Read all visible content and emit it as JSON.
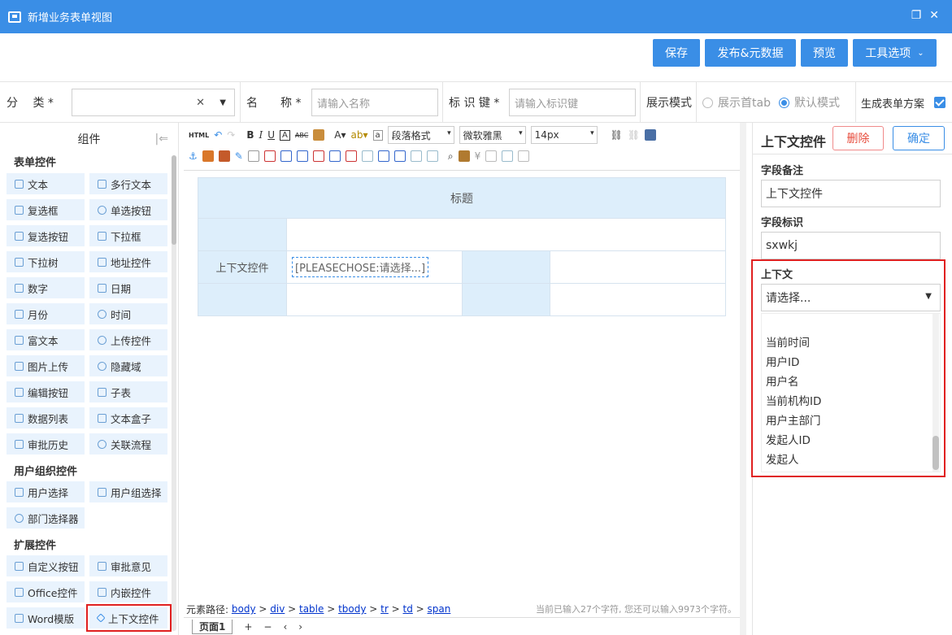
{
  "window": {
    "title": "新增业务表单视图"
  },
  "actions": {
    "save": "保存",
    "publish": "发布&元数据",
    "preview": "预览",
    "tools": "工具选项"
  },
  "form": {
    "category_label": "分　 类 *",
    "name_label": "名　　称 *",
    "name_placeholder": "请输入名称",
    "key_label": "标 识 键 *",
    "key_placeholder": "请输入标识键",
    "display_mode_label": "展示模式",
    "mode_first_tab": "展示首tab",
    "mode_default": "默认模式",
    "gen_plan_label": "生成表单方案"
  },
  "left_panel": {
    "title": "组件",
    "groups": [
      {
        "title": "表单控件",
        "items": [
          "文本",
          "多行文本",
          "复选框",
          "单选按钮",
          "复选按钮",
          "下拉框",
          "下拉树",
          "地址控件",
          "数字",
          "日期",
          "月份",
          "时间",
          "富文本",
          "上传控件",
          "图片上传",
          "隐藏域",
          "编辑按钮",
          "子表",
          "数据列表",
          "文本盒子",
          "审批历史",
          "关联流程"
        ]
      },
      {
        "title": "用户组织控件",
        "items": [
          "用户选择",
          "用户组选择",
          "部门选择器"
        ]
      },
      {
        "title": "扩展控件",
        "items": [
          "自定义按钮",
          "审批意见",
          "Office控件",
          "内嵌控件",
          "Word模版",
          "上下文控件"
        ]
      }
    ]
  },
  "editor": {
    "paragraph_select": "段落格式",
    "font_select": "微软雅黑",
    "size_select": "14px",
    "table_title": "标题",
    "row_label": "上下文控件",
    "placeholder_tag": "[PLEASECHOSE:请选择...]",
    "path_label": "元素路径:",
    "path": [
      "body",
      "div",
      "table",
      "tbody",
      "tr",
      "td",
      "span"
    ],
    "char_count": "当前已输入27个字符, 您还可以输入9973个字符。",
    "page_tab": "页面1",
    "page_controls": [
      "+",
      "−",
      "‹",
      "›"
    ]
  },
  "right_panel": {
    "title": "上下文控件",
    "delete": "删除",
    "confirm": "确定",
    "note_label": "字段备注",
    "note_value": "上下文控件",
    "key_label": "字段标识",
    "key_value": "sxwkj",
    "context_label": "上下文",
    "context_select": "请选择...",
    "options": [
      "当前时间",
      "用户ID",
      "用户名",
      "当前机构ID",
      "用户主部门",
      "发起人ID",
      "发起人"
    ]
  },
  "colors": {
    "accent": "#3a8ee6",
    "highlight": "#e02020",
    "cell_bg": "#ddeefb"
  }
}
